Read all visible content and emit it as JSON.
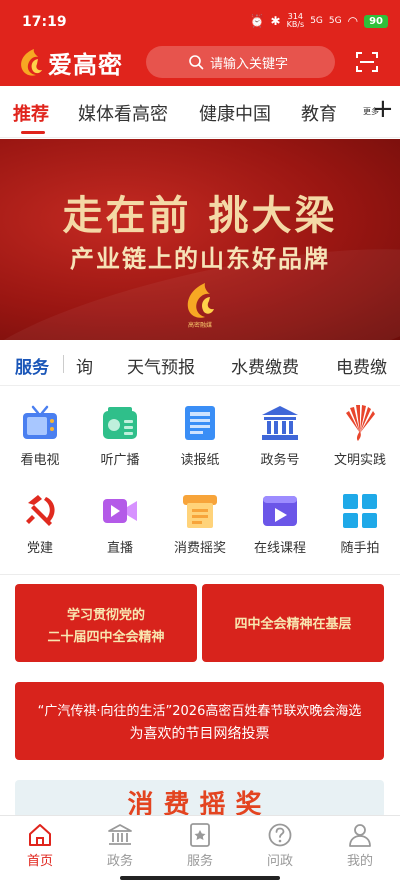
{
  "status_bar": {
    "time": "17:19",
    "net_speed_top": "314",
    "net_speed_bottom": "KB/s",
    "signal1": "5G",
    "signal2": "5G",
    "battery": "90"
  },
  "header": {
    "app_name": "爱高密",
    "search_placeholder": "请输入关键字",
    "accent_color": "#e0241c"
  },
  "tabs": [
    {
      "label": "推荐",
      "active": true
    },
    {
      "label": "媒体看高密",
      "active": false
    },
    {
      "label": "健康中国",
      "active": false
    },
    {
      "label": "教育",
      "active": false
    }
  ],
  "tab_more_label": "更多",
  "banner": {
    "line1": "走在前 挑大梁",
    "line2": "产业链上的山东好品牌",
    "logo_caption": "高密融媒"
  },
  "services": {
    "label": "服务",
    "items": [
      "询",
      "天气预报",
      "水费缴费",
      "电费缴"
    ]
  },
  "grid": [
    {
      "label": "看电视",
      "icon": "tv-icon"
    },
    {
      "label": "听广播",
      "icon": "radio-icon"
    },
    {
      "label": "读报纸",
      "icon": "newspaper-icon"
    },
    {
      "label": "政务号",
      "icon": "government-building-icon"
    },
    {
      "label": "文明实践",
      "icon": "fan-emblem-icon"
    },
    {
      "label": "党建",
      "icon": "party-emblem-icon"
    },
    {
      "label": "直播",
      "icon": "live-video-icon"
    },
    {
      "label": "消费摇奖",
      "icon": "lottery-icon"
    },
    {
      "label": "在线课程",
      "icon": "online-course-icon"
    },
    {
      "label": "随手拍",
      "icon": "grid-camera-icon"
    }
  ],
  "promo_cards": [
    {
      "line1": "学习贯彻党的",
      "line2": "二十届四中全会精神"
    },
    {
      "text": "四中全会精神在基层"
    }
  ],
  "promo_vote": {
    "line1": "“广汽传祺·向往的生活”2026高密百姓春节联欢晚会海选",
    "line2": "为喜欢的节目网络投票"
  },
  "promo_lottery": {
    "text": "消费摇奖"
  },
  "bottom_nav": [
    {
      "label": "首页",
      "icon": "home-icon",
      "active": true
    },
    {
      "label": "政务",
      "icon": "government-icon",
      "active": false
    },
    {
      "label": "服务",
      "icon": "service-icon",
      "active": false
    },
    {
      "label": "问政",
      "icon": "question-icon",
      "active": false
    },
    {
      "label": "我的",
      "icon": "user-icon",
      "active": false
    }
  ]
}
